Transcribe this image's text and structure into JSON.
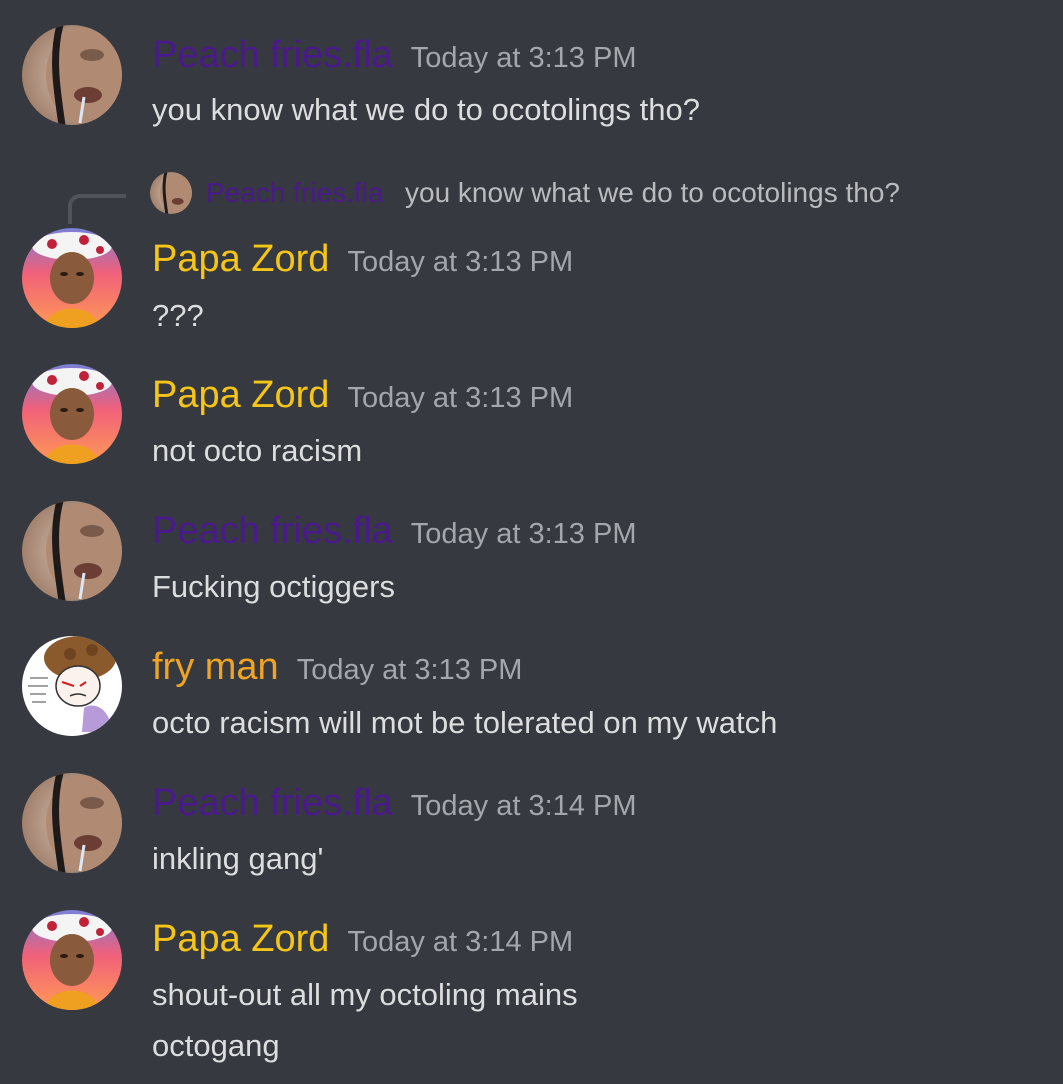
{
  "colors": {
    "background": "#36393f",
    "peach_name": "#4b1a8a",
    "papa_name": "#f5c518",
    "fry_name": "#f0a424",
    "timestamp": "#a3a6aa",
    "message_text": "#dcddde"
  },
  "reply": {
    "username": "Peach fries.fla",
    "text": "you know what we do to ocotolings tho?",
    "avatar_icon": "peach-avatar"
  },
  "messages": [
    {
      "username": "Peach fries.fla",
      "timestamp": "Today at 3:13 PM",
      "lines": [
        "you know what we do to ocotolings tho?"
      ],
      "avatar_icon": "peach-avatar"
    },
    {
      "username": "Papa Zord",
      "timestamp": "Today at 3:13 PM",
      "lines": [
        "???"
      ],
      "avatar_icon": "papa-zord-avatar"
    },
    {
      "username": "Papa Zord",
      "timestamp": "Today at 3:13 PM",
      "lines": [
        "not octo racism"
      ],
      "avatar_icon": "papa-zord-avatar"
    },
    {
      "username": "Peach fries.fla",
      "timestamp": "Today at 3:13 PM",
      "lines": [
        "Fucking octiggers"
      ],
      "avatar_icon": "peach-avatar"
    },
    {
      "username": "fry man",
      "timestamp": "Today at 3:13 PM",
      "lines": [
        "octo racism will mot be tolerated on my watch"
      ],
      "avatar_icon": "fry-man-avatar"
    },
    {
      "username": "Peach fries.fla",
      "timestamp": "Today at 3:14 PM",
      "lines": [
        "inkling gang'"
      ],
      "avatar_icon": "peach-avatar"
    },
    {
      "username": "Papa Zord",
      "timestamp": "Today at 3:14 PM",
      "lines": [
        "shout-out all my octoling mains",
        "octogang"
      ],
      "avatar_icon": "papa-zord-avatar"
    }
  ]
}
